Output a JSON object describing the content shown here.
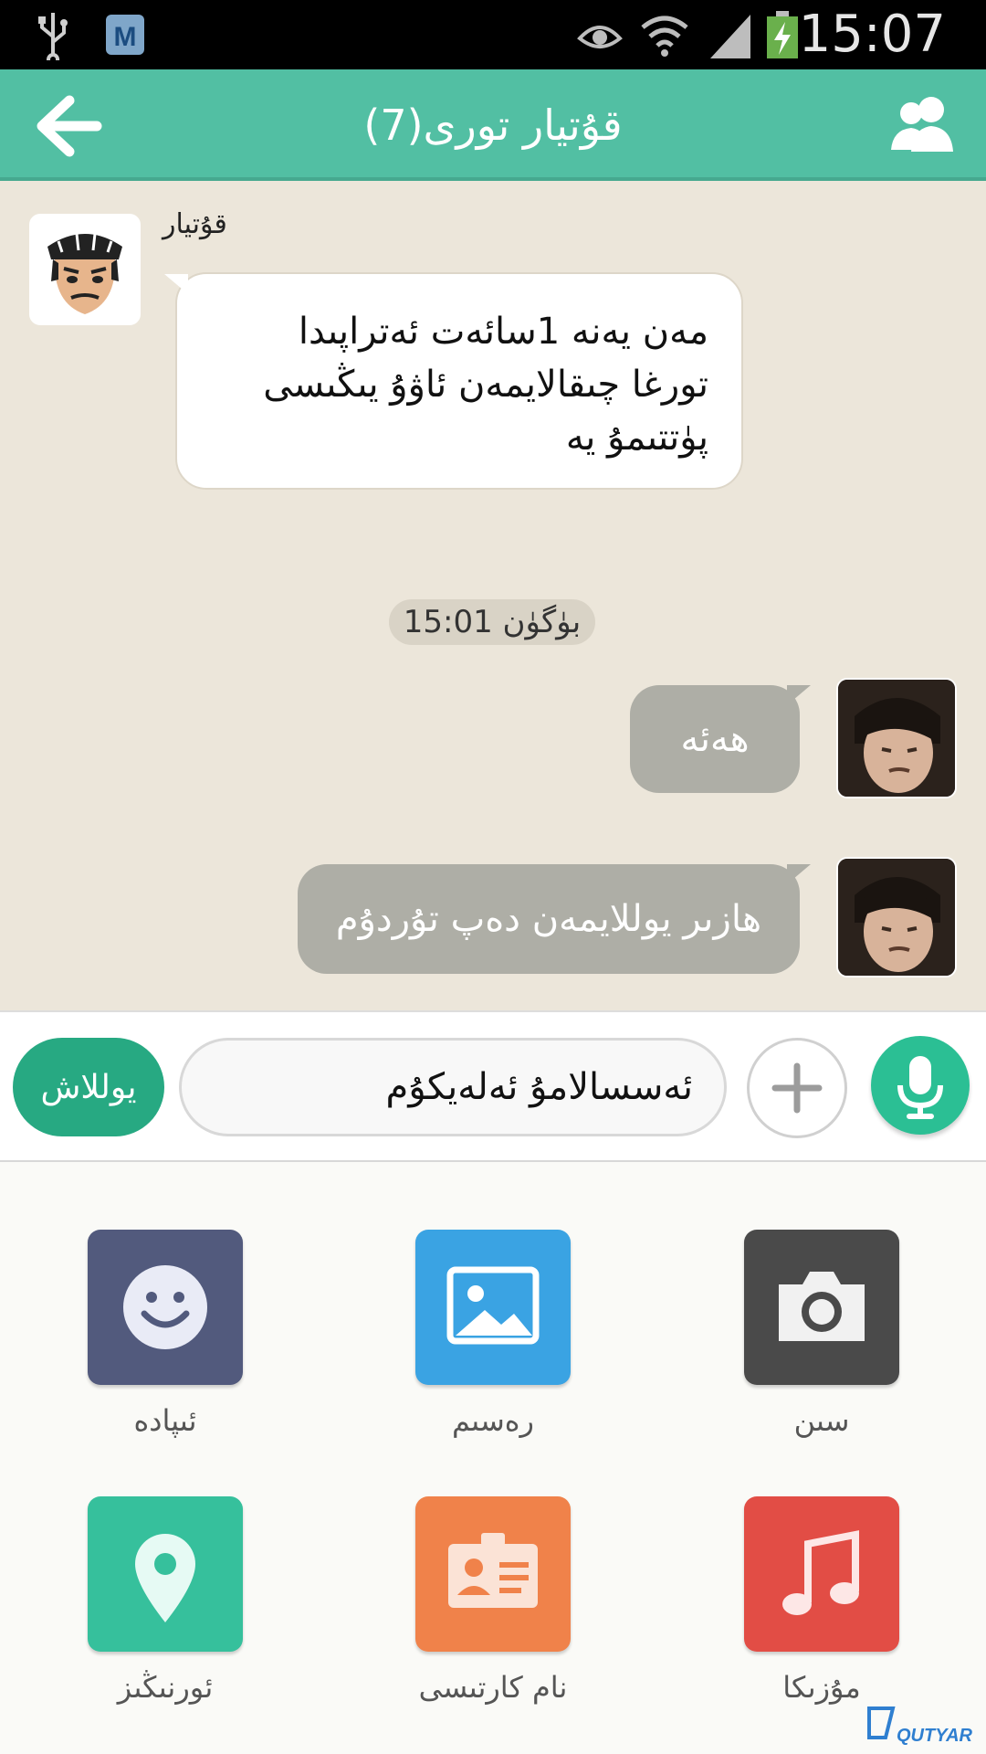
{
  "status_bar": {
    "time": "15:07",
    "icons": [
      "usb-icon",
      "app-shield-icon",
      "eye-icon",
      "wifi-icon",
      "signal-icon",
      "battery-charging-icon"
    ],
    "battery_color": "#6ab04c"
  },
  "header": {
    "title": "قۇتيار تورى(7)",
    "back_icon": "arrow-left-icon",
    "members_icon": "group-members-icon",
    "color": "#52bfa3"
  },
  "chat": {
    "messages": [
      {
        "direction": "incoming",
        "sender": "قۇتيار",
        "avatar": "cartoon-man-avatar",
        "lines": [
          "مەن يەنە 1سائەت ئەتراپىدا",
          "تورغا چىقالايمەن ئاۋۇ يىڭىسى",
          "پۈتتىمۇ يە"
        ]
      },
      {
        "type": "timestamp",
        "text": "بۈگۈن 15:01"
      },
      {
        "direction": "outgoing",
        "avatar": "user-photo-avatar",
        "text": "ھەئە"
      },
      {
        "direction": "outgoing",
        "avatar": "user-photo-avatar",
        "text": "ھازىر يوللايمەن دەپ تۇردۇم"
      }
    ]
  },
  "input": {
    "send_label": "يوللاش",
    "value": "ئەسسالامۇ ئەلەيكۇم",
    "plus_icon": "plus-icon",
    "mic_icon": "microphone-icon"
  },
  "panel": {
    "items": [
      {
        "label": "ئىپادە",
        "icon": "smiley-icon",
        "color": "#525a7d"
      },
      {
        "label": "رەسىم",
        "icon": "image-icon",
        "color": "#3aa3e3"
      },
      {
        "label": "سىن",
        "icon": "camera-icon",
        "color": "#4a4a4a"
      },
      {
        "label": "ئورنىڭىز",
        "icon": "location-pin-icon",
        "color": "#36c09c"
      },
      {
        "label": "نام كارتىسى",
        "icon": "contact-card-icon",
        "color": "#f0824a"
      },
      {
        "label": "مۇزىكا",
        "icon": "music-note-icon",
        "color": "#e24d45"
      }
    ]
  },
  "brand": {
    "logo_text": "QUTYAR"
  }
}
